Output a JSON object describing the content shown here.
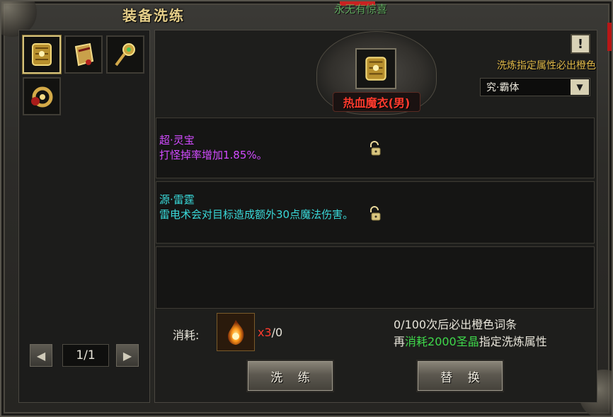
{
  "window": {
    "title": "装备洗练",
    "background_text": "永无有惊喜"
  },
  "equipment_list": {
    "items": [
      {
        "name": "armor-icon",
        "selected": true
      },
      {
        "name": "bracer-icon",
        "selected": false
      },
      {
        "name": "scepter-icon",
        "selected": false
      },
      {
        "name": "ring-icon",
        "selected": false
      }
    ],
    "pager": {
      "text": "1/1",
      "prev": "◀",
      "next": "▶"
    }
  },
  "item": {
    "name": "热血魔衣(男)",
    "name_color": "#ff3b2e"
  },
  "hint": {
    "warn_glyph": "!",
    "text": "洗炼指定属性必出橙色",
    "select_value": "究·霸体",
    "select_arrow": "▼"
  },
  "attributes": [
    {
      "title": "超·灵宝",
      "desc": "打怪掉率增加1.85%。",
      "color": "#d24bff",
      "locked": false
    },
    {
      "title": "源·雷霆",
      "desc": "雷电术会对目标造成额外30点魔法伤害。",
      "color": "#39d8d8",
      "locked": false
    },
    {
      "title": "",
      "desc": "",
      "color": "#ffffff",
      "locked": false
    }
  ],
  "cost": {
    "label": "消耗:",
    "count_prefix": "x3",
    "count_suffix": "/0"
  },
  "info": {
    "line1": "0/100次后必出橙色词条",
    "line2_a": "再",
    "line2_b": "消耗2000圣晶",
    "line2_c": "指定洗炼属性"
  },
  "buttons": {
    "refine": "洗 练",
    "replace": "替 换"
  }
}
